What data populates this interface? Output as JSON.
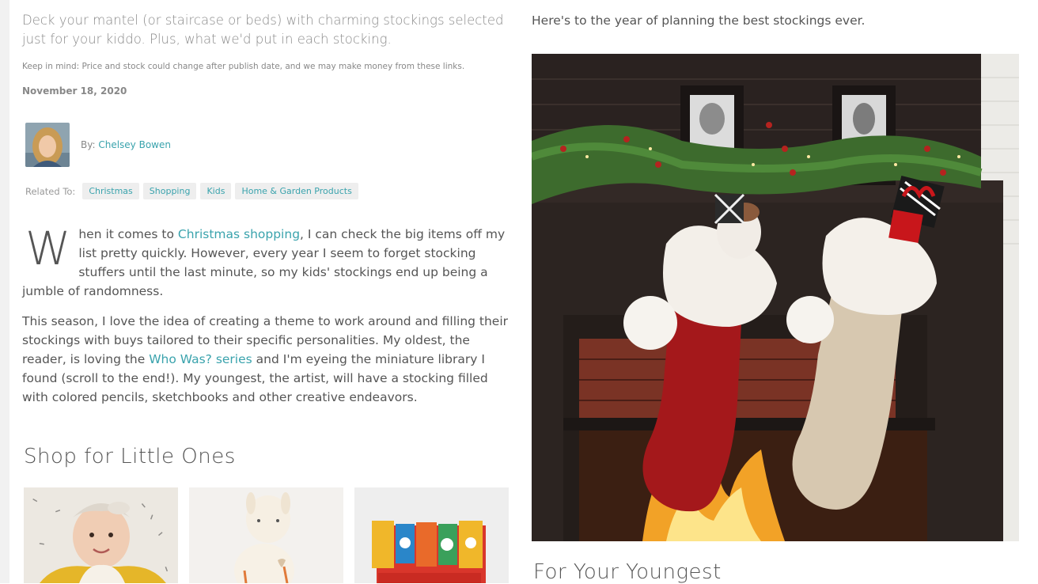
{
  "deck": "Deck your mantel (or staircase or beds) with charming stockings selected just for your kiddo. Plus, what we'd put in each stocking.",
  "disclaimer": "Keep in mind: Price and stock could change after publish date, and we may make money from these links.",
  "date": "November 18, 2020",
  "byline": {
    "prefix": "By:",
    "author": "Chelsey Bowen"
  },
  "related": {
    "label": "Related To:",
    "tags": [
      "Christmas",
      "Shopping",
      "Kids",
      "Home & Garden Products"
    ]
  },
  "paragraph1": {
    "dropcap": "W",
    "before": "hen it comes to ",
    "link": "Christmas shopping",
    "after": ", I can check the big items off my list pretty quickly. However, every year I seem to forget stocking stuffers until the last minute, so my kids' stockings end up being a jumble of randomness."
  },
  "paragraph2": {
    "before": "This season, I love the idea of creating a theme to work around and filling their stockings with buys tailored to their specific personalities. My oldest, the reader, is loving the ",
    "link": "Who Was? series",
    "after": " and I'm eyeing the miniature library I found (scroll to the end!). My youngest, the artist, will have a stocking filled with colored pencils, sketchbooks and other creative endeavors."
  },
  "section_heading": "Shop for Little Ones",
  "intro_right": "Here's to the year of planning the best stockings ever.",
  "right_heading": "For Your Youngest",
  "colors": {
    "link": "#3aa3ad",
    "text": "#555555",
    "tag_bg": "#eeeeee"
  }
}
